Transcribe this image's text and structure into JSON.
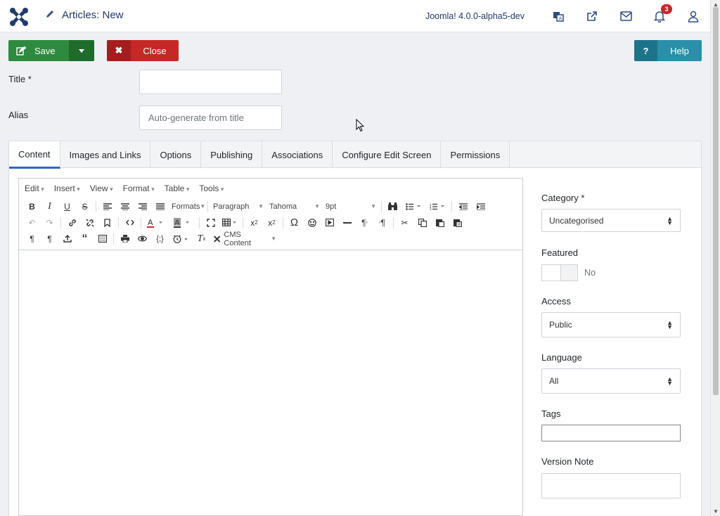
{
  "header": {
    "title": "Articles: New",
    "version": "Joomla! 4.0.0-alpha5-dev",
    "notifications_count": "3",
    "icons": [
      "joomla-logo-icon",
      "pencil-icon",
      "language-icon",
      "external-link-icon",
      "mail-icon",
      "bell-icon",
      "user-icon"
    ]
  },
  "toolbar": {
    "save_label": "Save",
    "close_label": "Close",
    "help_label": "Help",
    "help_icon": "?",
    "colors": {
      "save": "#2e8a3e",
      "close": "#c52827",
      "help": "#2a8fa8"
    }
  },
  "form": {
    "title_label": "Title *",
    "title_value": "",
    "alias_label": "Alias",
    "alias_placeholder": "Auto-generate from title"
  },
  "tabs": [
    {
      "label": "Content",
      "active": true
    },
    {
      "label": "Images and Links"
    },
    {
      "label": "Options"
    },
    {
      "label": "Publishing"
    },
    {
      "label": "Associations"
    },
    {
      "label": "Configure Edit Screen"
    },
    {
      "label": "Permissions"
    }
  ],
  "editor": {
    "menus": [
      "Edit",
      "Insert",
      "View",
      "Format",
      "Table",
      "Tools"
    ],
    "formats_label": "Formats",
    "block_format": "Paragraph",
    "font_family": "Tahoma",
    "font_size": "9pt",
    "cms_content_label": "CMS Content"
  },
  "sidebar": {
    "category_label": "Category *",
    "category_value": "Uncategorised",
    "featured_label": "Featured",
    "featured_value": "No",
    "access_label": "Access",
    "access_value": "Public",
    "language_label": "Language",
    "language_value": "All",
    "tags_label": "Tags",
    "version_note_label": "Version Note"
  }
}
